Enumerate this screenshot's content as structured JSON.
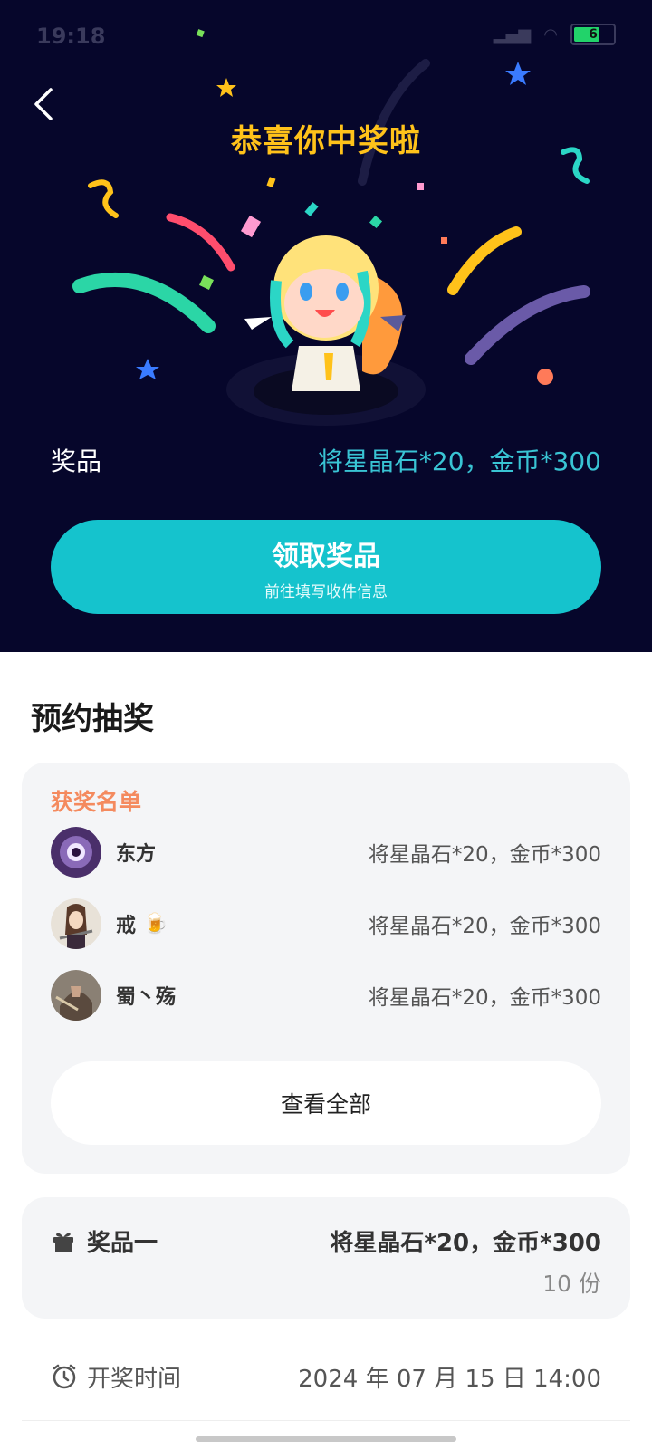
{
  "status_bar": {
    "time": "19:18",
    "battery": "6"
  },
  "hero": {
    "title": "恭喜你中奖啦",
    "prize_label": "奖品",
    "prize_value": "将星晶石*20，金币*300",
    "claim_button": {
      "label": "领取奖品",
      "sublabel": "前往填写收件信息"
    }
  },
  "section_title": "预约抽奖",
  "winners": {
    "header": "获奖名单",
    "list": [
      {
        "name": "东方",
        "prize": "将星晶石*20，金币*300"
      },
      {
        "name": "戒",
        "emoji": "🍺",
        "prize": "将星晶石*20，金币*300"
      },
      {
        "name": "蜀丶殇",
        "prize": "将星晶石*20，金币*300"
      }
    ],
    "view_all": "查看全部"
  },
  "prize_item": {
    "name": "奖品一",
    "value": "将星晶石*20，金币*300",
    "quantity": "10 份"
  },
  "draw": {
    "label": "开奖时间",
    "time": "2024 年 07 月 15 日 14:00"
  },
  "colors": {
    "hero_bg": "#06062b",
    "accent": "#15c3cd",
    "title": "#ffc21a",
    "winner_header": "#f48a5e"
  }
}
